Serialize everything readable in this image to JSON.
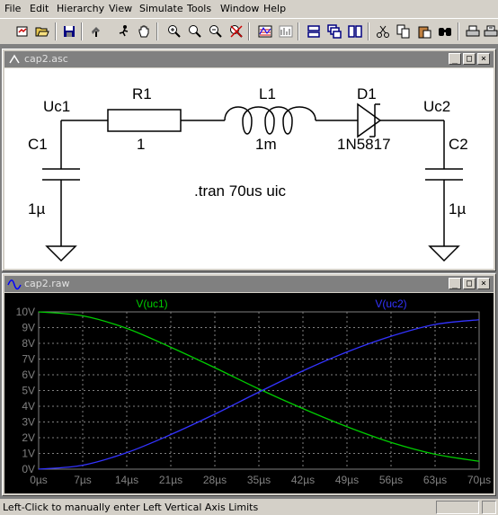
{
  "menu": {
    "items": [
      {
        "label": "File",
        "mnemonic": "F"
      },
      {
        "label": "Edit",
        "mnemonic": "E"
      },
      {
        "label": "Hierarchy",
        "mnemonic": "H"
      },
      {
        "label": "View",
        "mnemonic": "V"
      },
      {
        "label": "Simulate",
        "mnemonic": "S"
      },
      {
        "label": "Tools",
        "mnemonic": "T"
      },
      {
        "label": "Window",
        "mnemonic": "W"
      },
      {
        "label": "Help",
        "mnemonic": "H"
      }
    ]
  },
  "toolbar": {
    "buttons": [
      "new-schematic-icon",
      "open-icon",
      "save-icon",
      "control-panel-icon",
      "run-icon",
      "pan-icon",
      "zoom-in-icon",
      "zoom-full-icon",
      "zoom-out-icon",
      "cancel-zoom-icon",
      "waveform-icon",
      "fft-icon",
      "tile-horizontal-icon",
      "cascade-icon",
      "tile-vertical-icon",
      "cut-icon",
      "copy-icon",
      "paste-icon",
      "find-icon",
      "print-icon",
      "print-setup-icon"
    ]
  },
  "schematic_window": {
    "title": "cap2.asc",
    "labels": {
      "uc1": "Uc1",
      "uc2": "Uc2",
      "r1_name": "R1",
      "r1_value": "1",
      "l1_name": "L1",
      "l1_value": "1m",
      "d1_name": "D1",
      "d1_value": "1N5817",
      "c1_name": "C1",
      "c1_value": "1µ",
      "c2_name": "C2",
      "c2_value": "1µ",
      "directive": ".tran 70us uic"
    }
  },
  "plot_window": {
    "title": "cap2.raw"
  },
  "chart_data": {
    "type": "line",
    "xlabel": "",
    "ylabel": "",
    "x_ticks": [
      "0µs",
      "7µs",
      "14µs",
      "21µs",
      "28µs",
      "35µs",
      "42µs",
      "49µs",
      "56µs",
      "63µs",
      "70µs"
    ],
    "y_ticks": [
      "0V",
      "1V",
      "2V",
      "3V",
      "4V",
      "5V",
      "6V",
      "7V",
      "8V",
      "9V",
      "10V"
    ],
    "xlim": [
      0,
      70
    ],
    "ylim": [
      0,
      10
    ],
    "grid": true,
    "x": [
      0,
      7,
      14,
      21,
      28,
      35,
      42,
      49,
      56,
      63,
      70
    ],
    "series": [
      {
        "name": "V(uc1)",
        "color": "#00cc00",
        "values": [
          10.0,
          9.75,
          8.95,
          7.75,
          6.45,
          5.1,
          3.85,
          2.7,
          1.7,
          0.95,
          0.5
        ]
      },
      {
        "name": "V(uc2)",
        "color": "#3333ff",
        "values": [
          0.0,
          0.25,
          1.05,
          2.2,
          3.5,
          4.9,
          6.25,
          7.45,
          8.45,
          9.2,
          9.5
        ]
      }
    ],
    "background": "#000000",
    "grid_color": "#808080"
  },
  "status": {
    "text": "Left-Click to manually enter Left Vertical Axis Limits"
  }
}
